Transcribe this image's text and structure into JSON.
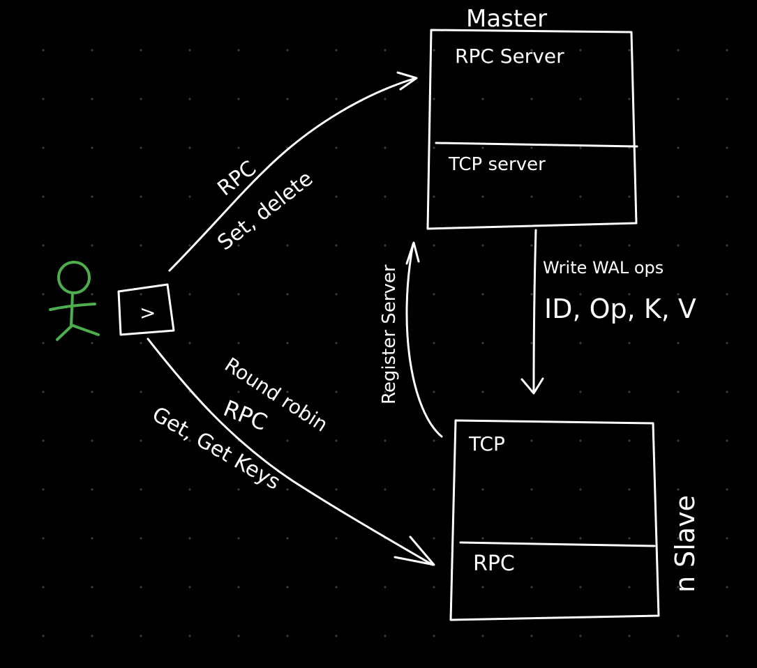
{
  "colors": {
    "background": "#000000",
    "ink": "#ffffff",
    "grid_dot": "#3a3a3a",
    "actor": "#4cae4c"
  },
  "master": {
    "title": "Master",
    "top_section": "RPC Server",
    "bottom_section": "TCP server"
  },
  "slave": {
    "title": "n Slave",
    "top_section": "TCP",
    "bottom_section": "RPC"
  },
  "client": {
    "icon": "terminal-prompt-icon",
    "glyph": ">"
  },
  "actor": {
    "icon": "stick-figure-user-icon"
  },
  "edges": {
    "client_to_master": {
      "label_1": "RPC",
      "label_2": "Set, delete"
    },
    "client_to_slave": {
      "label_1": "Round robin",
      "label_2": "RPC",
      "label_3": "Get, Get Keys"
    },
    "master_to_slave": {
      "label_1": "Write WAL ops",
      "label_2": "ID, Op, K, V"
    },
    "slave_to_master": {
      "label_1": "Register Server"
    }
  }
}
